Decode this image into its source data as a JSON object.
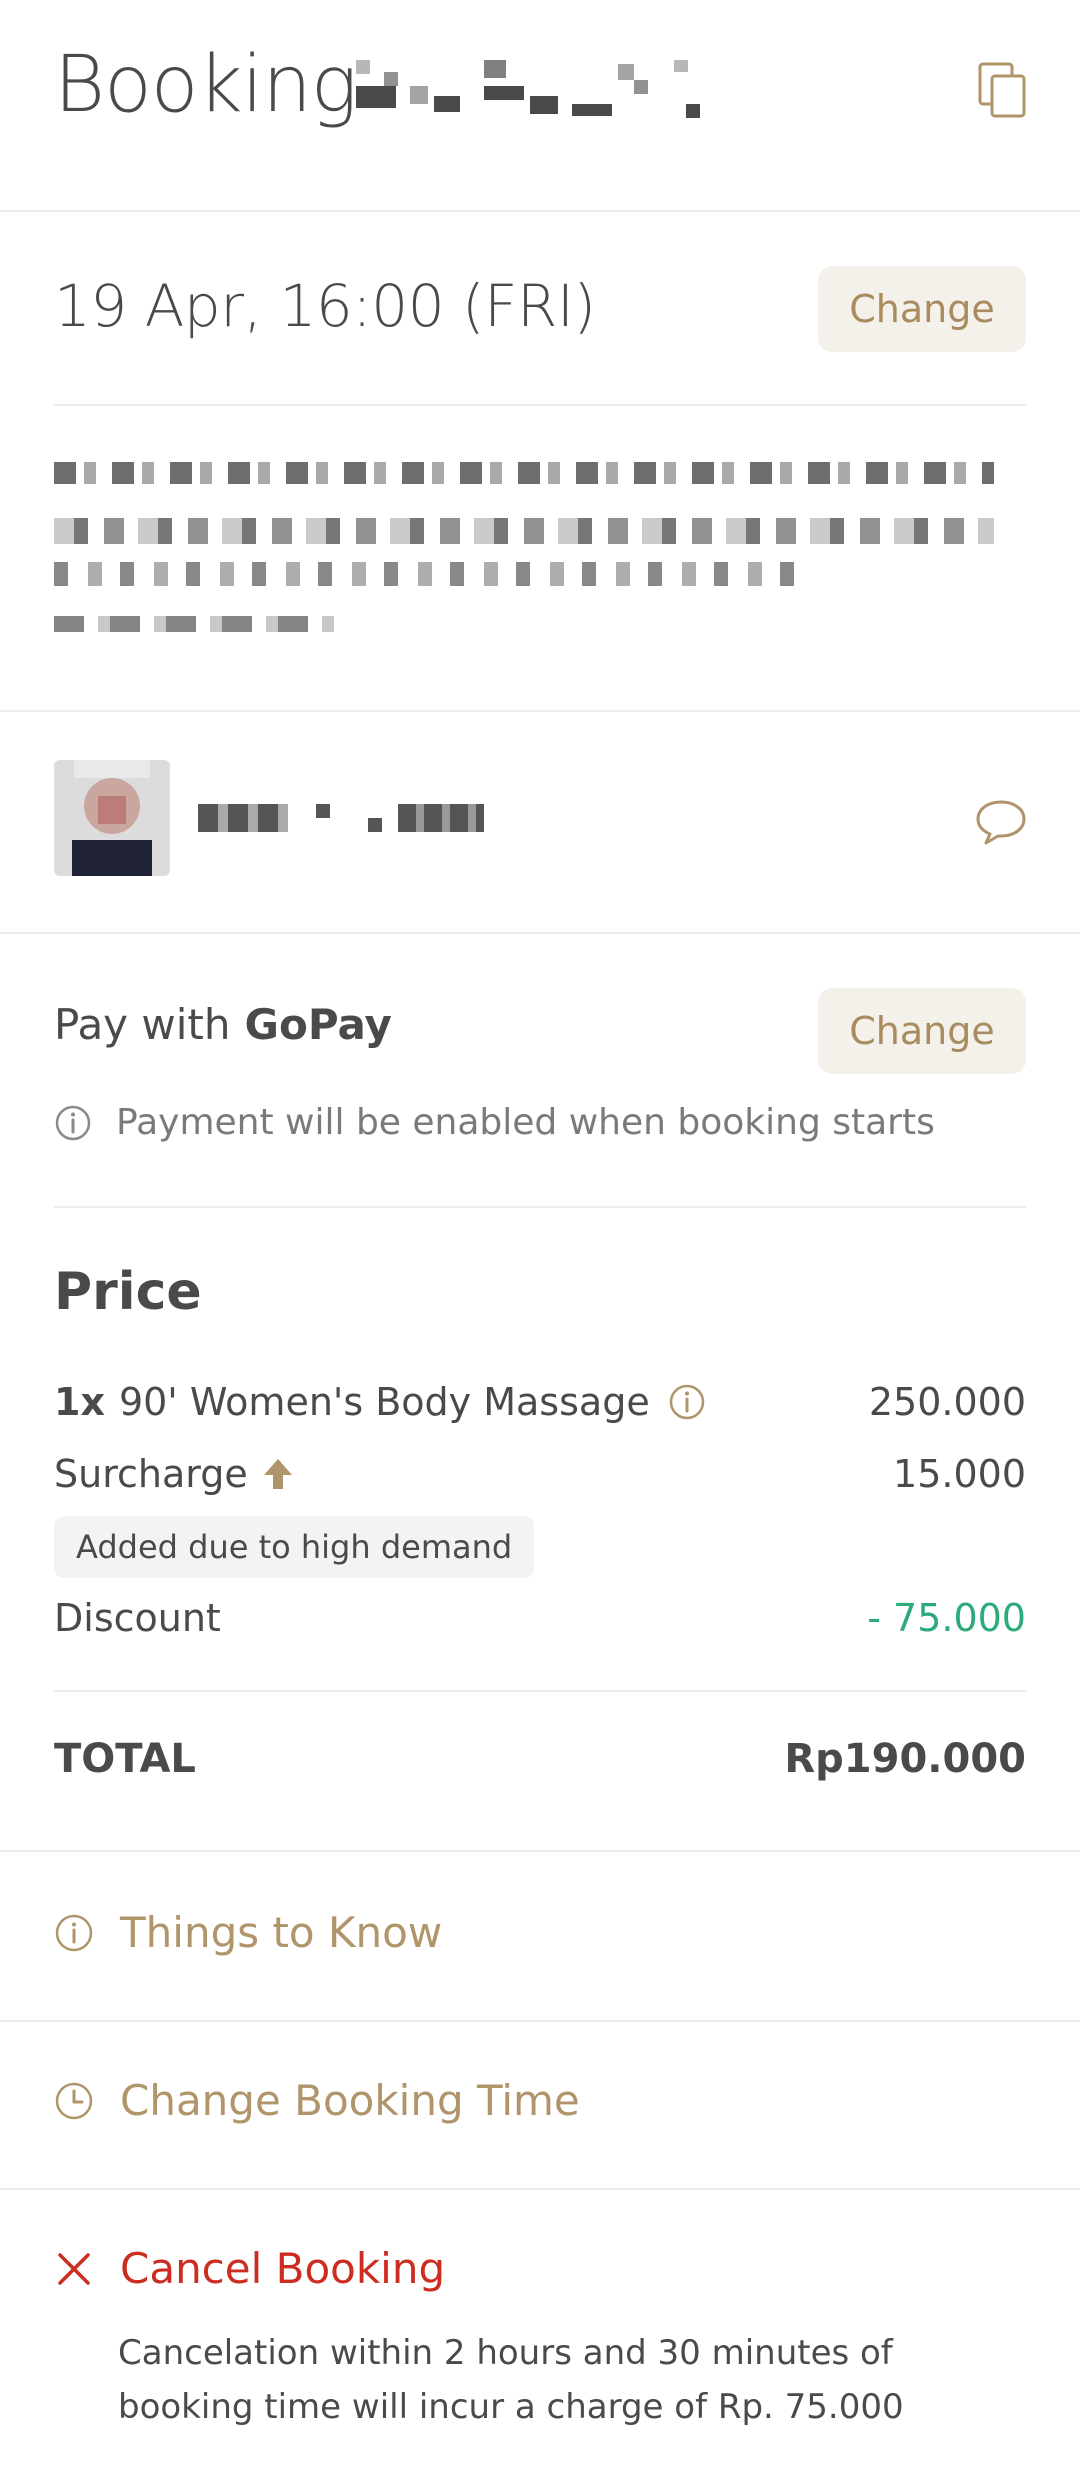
{
  "header": {
    "title": "Booking"
  },
  "schedule": {
    "datetime": "19 Apr, 16:00 (FRI)",
    "change_label": "Change"
  },
  "payment": {
    "prefix": "Pay with",
    "method": "GoPay",
    "change_label": "Change",
    "note": "Payment will be enabled when booking starts"
  },
  "price": {
    "heading": "Price",
    "items": [
      {
        "qty": "1x",
        "label": "90' Women's Body Massage",
        "value": "250.000"
      }
    ],
    "surcharge": {
      "label": "Surcharge",
      "value": "15.000",
      "badge": "Added due to high demand"
    },
    "discount": {
      "label": "Discount",
      "value": "- 75.000"
    },
    "total": {
      "label": "TOTAL",
      "value": "Rp190.000"
    }
  },
  "actions": {
    "things_to_know": "Things to Know",
    "change_time": "Change Booking Time",
    "cancel": "Cancel Booking",
    "cancel_note": "Cancelation within 2 hours and 30 minutes of booking time will incur a charge of Rp. 75.000"
  },
  "colors": {
    "accent": "#b0946a",
    "button_bg": "#f4f1ea",
    "discount": "#2bab7a",
    "cancel": "#cc2d20",
    "text": "#4a4a4a"
  },
  "icons": {
    "copy": "copy-icon",
    "chat": "chat-bubble-icon",
    "info": "info-icon",
    "surcharge": "arrow-up-icon",
    "clock": "clock-icon",
    "close": "close-icon"
  }
}
